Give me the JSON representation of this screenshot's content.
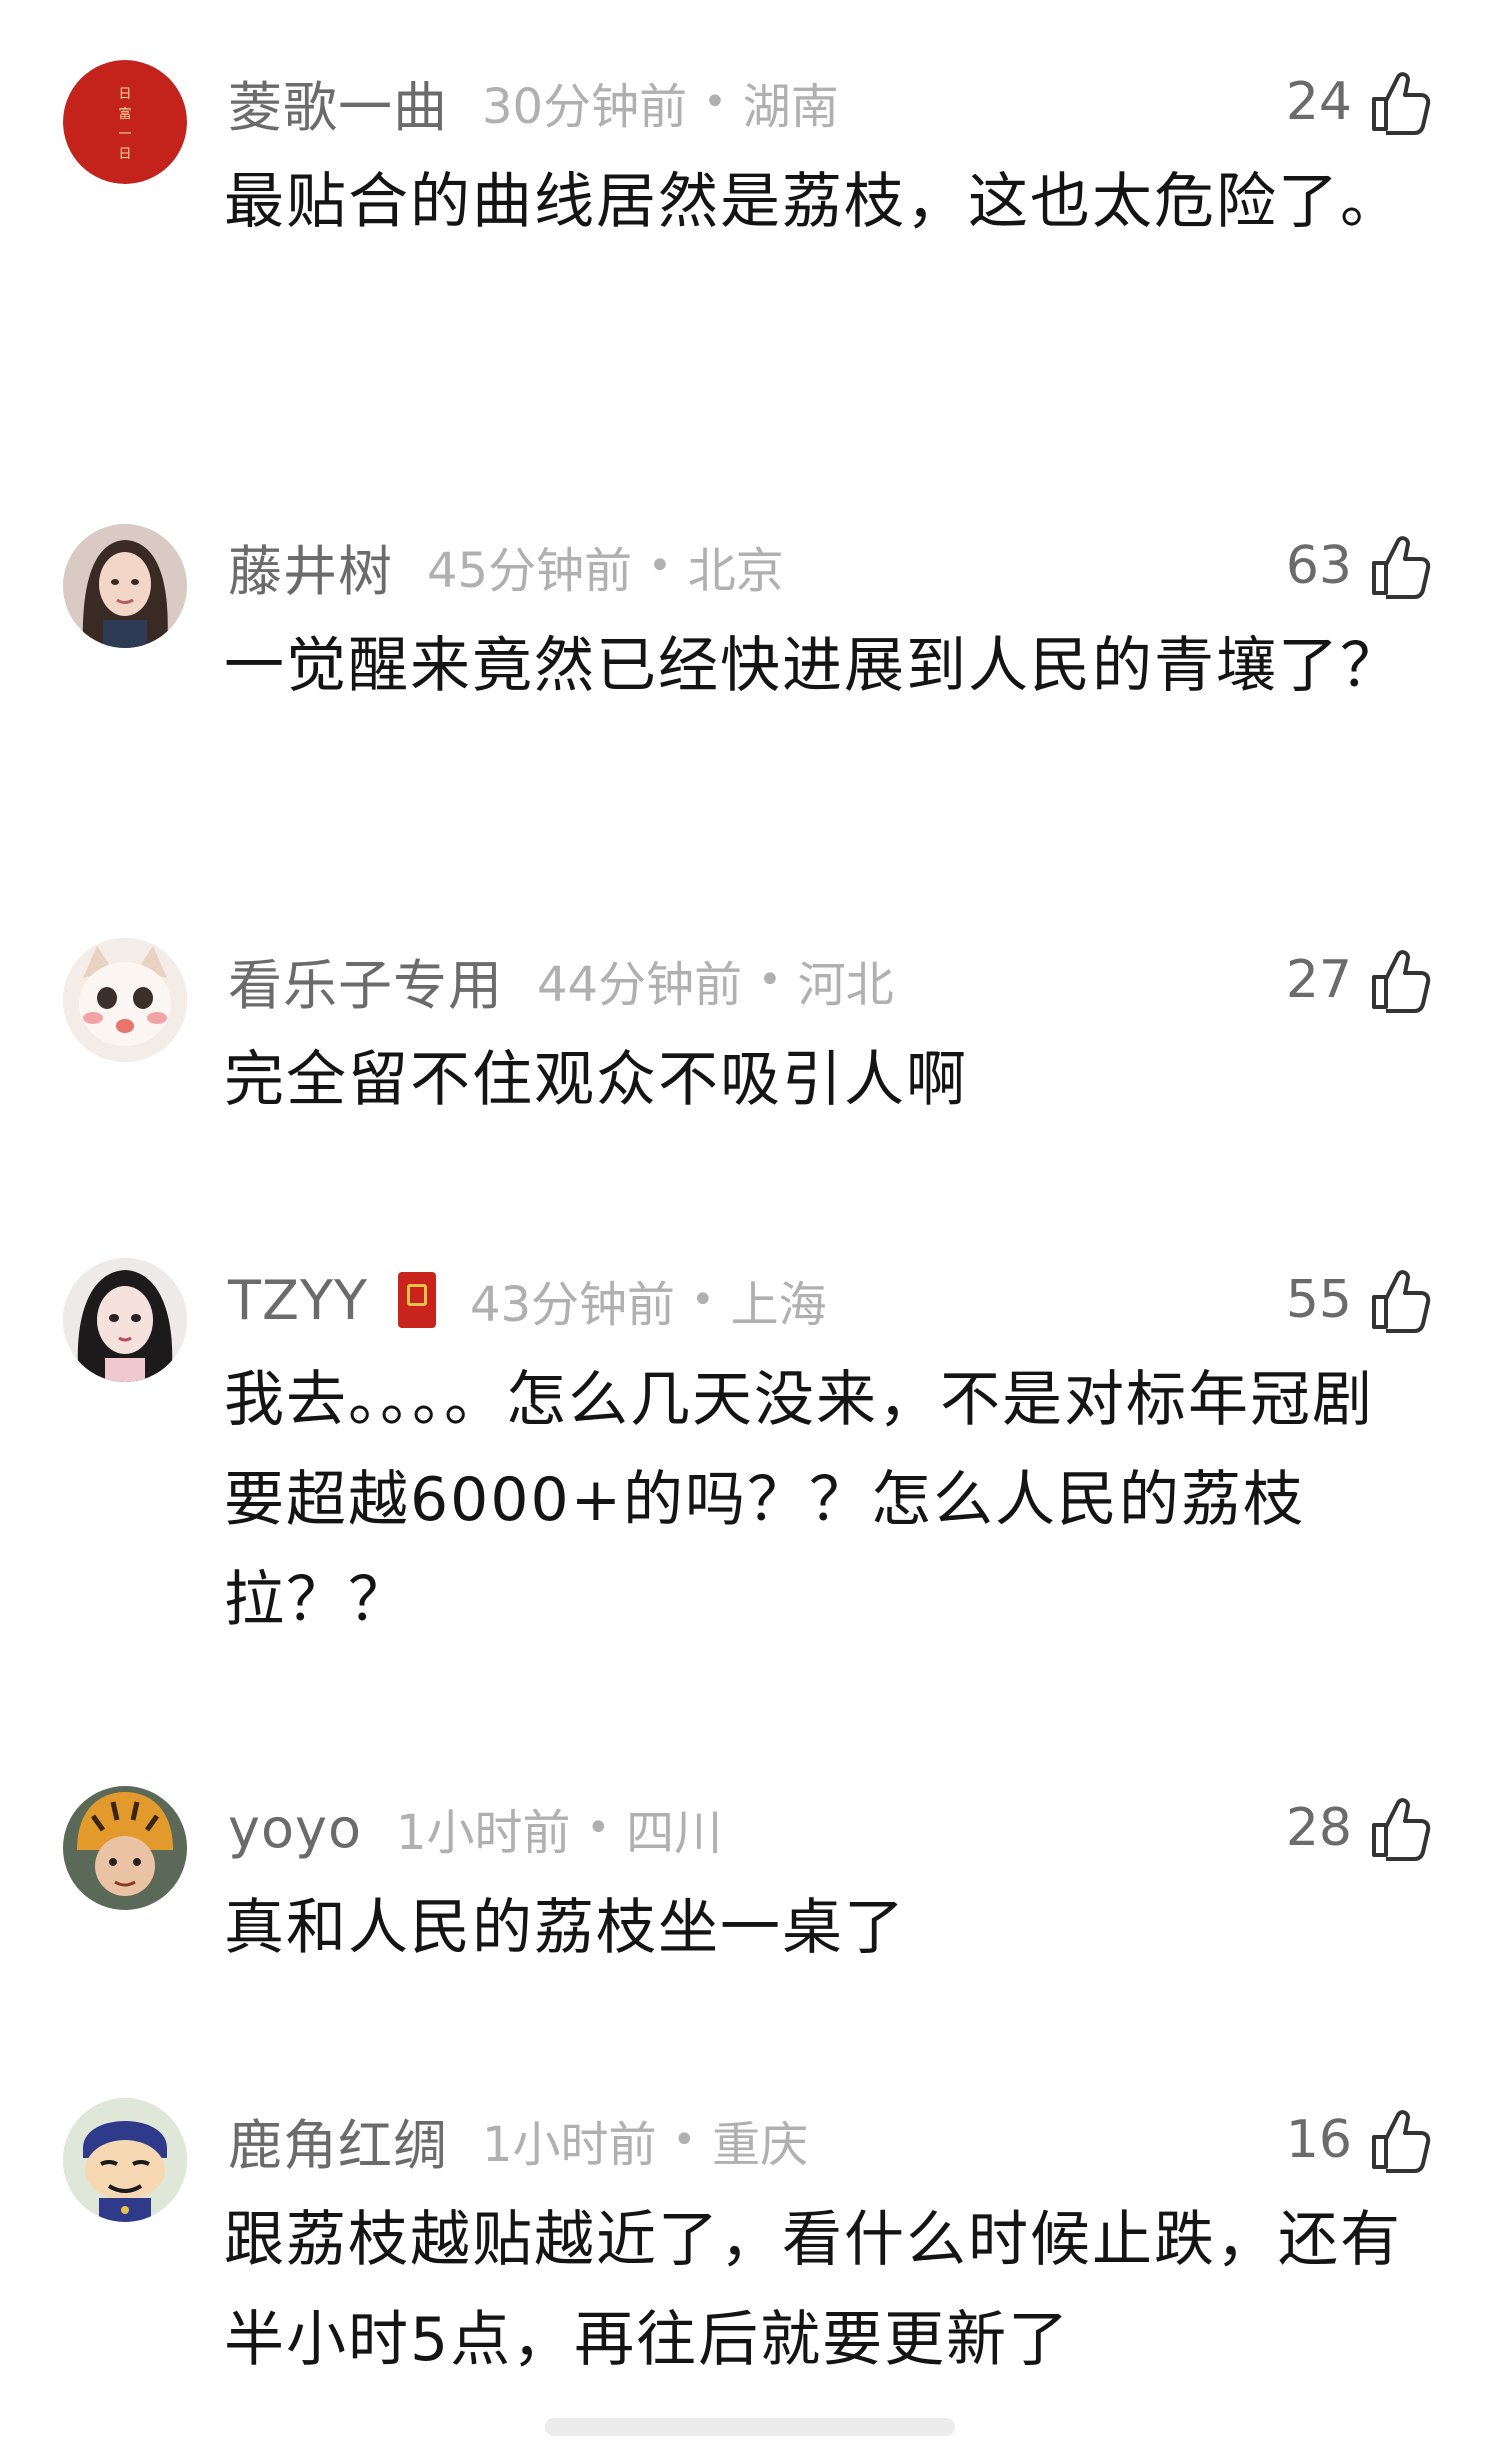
{
  "comments": [
    {
      "username": "菱歌一曲",
      "time": "30分钟前",
      "region": "湖南",
      "likes": "24",
      "text": "最贴合的曲线居然是荔枝，这也太危险了。",
      "avatar_icon": "red-seal-avatar",
      "avatar_seal_text": "日富一日"
    },
    {
      "username": "藤井树",
      "time": "45分钟前",
      "region": "北京",
      "likes": "63",
      "text": "一觉醒来竟然已经快进展到人民的青壤了？",
      "avatar_icon": "girl-portrait-avatar"
    },
    {
      "username": "看乐子专用",
      "time": "44分钟前",
      "region": "河北",
      "likes": "27",
      "text": "完全留不住观众不吸引人啊",
      "avatar_icon": "kitten-avatar"
    },
    {
      "username": "TZYY",
      "time": "43分钟前",
      "region": "上海",
      "likes": "55",
      "text": "我去。。。。怎么几天没来，不是对标年冠剧要超越6000+的吗？？怎么人民的荔枝拉？？",
      "avatar_icon": "illustrated-girl-avatar",
      "has_badge": true
    },
    {
      "username": "yoyo",
      "time": "1小时前",
      "region": "四川",
      "likes": "28",
      "text": "真和人民的荔枝坐一桌了",
      "avatar_icon": "tiger-hat-avatar"
    },
    {
      "username": "鹿角红绸",
      "time": "1小时前",
      "region": "重庆",
      "likes": "16",
      "text": "跟荔枝越贴越近了，看什么时候止跌，还有半小时5点，再往后就要更新了",
      "avatar_icon": "cartoon-boy-avatar"
    }
  ],
  "separator": "•",
  "icons": {
    "like": "thumbs-up-icon",
    "badge": "red-book-badge-icon"
  },
  "colors": {
    "username": "#6b6b6b",
    "meta": "#b0b0b0",
    "text": "#141414"
  }
}
